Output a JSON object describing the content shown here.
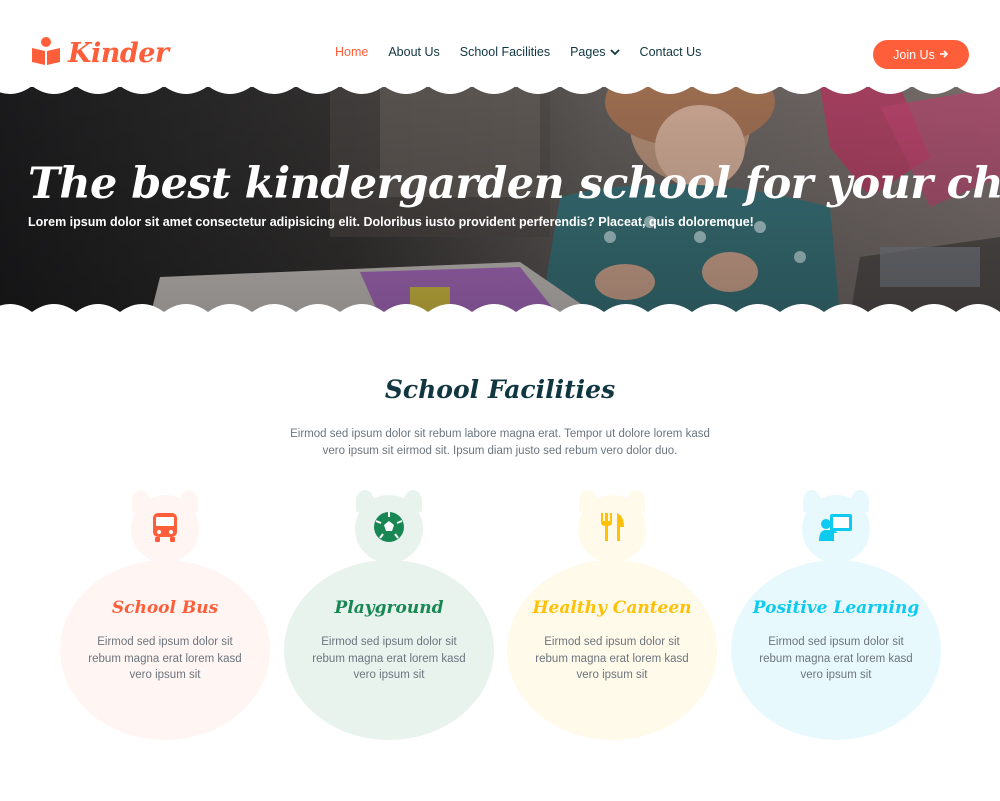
{
  "brand": {
    "name": "Kinder",
    "icon": "book-reader-icon",
    "color": "#ff5e3a"
  },
  "nav": {
    "items": [
      {
        "label": "Home",
        "active": true
      },
      {
        "label": "About Us",
        "active": false
      },
      {
        "label": "School Facilities",
        "active": false
      },
      {
        "label": "Pages",
        "active": false,
        "dropdown": true
      },
      {
        "label": "Contact Us",
        "active": false
      }
    ],
    "cta_label": "Join Us",
    "cta_icon": "arrow-right-icon"
  },
  "hero": {
    "title": "The best kindergarden school for your child",
    "subtitle": "Lorem ipsum dolor sit amet consectetur adipisicing elit. Doloribus iusto provident perferendis? Placeat, quis doloremque!"
  },
  "facilities": {
    "title": "School Facilities",
    "description": "Eirmod sed ipsum dolor sit rebum labore magna erat. Tempor ut dolore lorem kasd vero ipsum sit eirmod sit. Ipsum diam justo sed rebum vero dolor duo.",
    "cards": [
      {
        "title": "School Bus",
        "text": "Eirmod sed ipsum dolor sit rebum magna erat lorem kasd vero ipsum sit",
        "icon": "bus-icon",
        "accent": "#ff5e3a",
        "bg": "#fff5f3"
      },
      {
        "title": "Playground",
        "text": "Eirmod sed ipsum dolor sit rebum magna erat lorem kasd vero ipsum sit",
        "icon": "soccer-ball-icon",
        "accent": "#198754",
        "bg": "#e8f3ee"
      },
      {
        "title": "Healthy Canteen",
        "text": "Eirmod sed ipsum dolor sit rebum magna erat lorem kasd vero ipsum sit",
        "icon": "utensils-icon",
        "accent": "#ffc107",
        "bg": "#fffaea"
      },
      {
        "title": "Positive Learning",
        "text": "Eirmod sed ipsum dolor sit rebum magna erat lorem kasd vero ipsum sit",
        "icon": "chalkboard-teacher-icon",
        "accent": "#0dcaf0",
        "bg": "#e7f9fd"
      }
    ]
  }
}
